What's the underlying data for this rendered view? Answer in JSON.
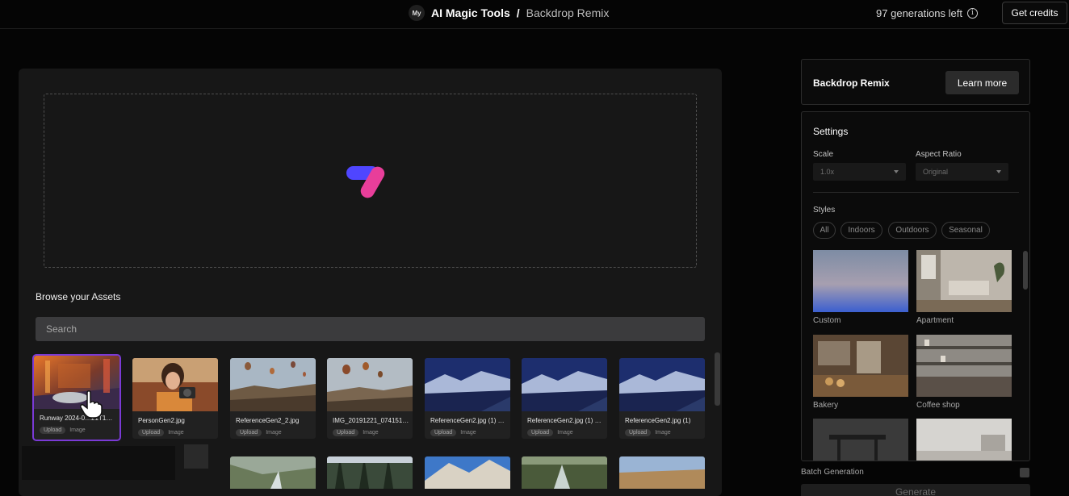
{
  "header": {
    "workspace_badge": "My",
    "app_name": "AI Magic Tools",
    "separator": "/",
    "page_name": "Backdrop Remix",
    "generations_left": "97 generations left",
    "get_credits_label": "Get credits"
  },
  "main": {
    "browse_title": "Browse your Assets",
    "search_placeholder": "Search",
    "assets": [
      {
        "name": "Runway 2024-0…21T1…",
        "tag": "Upload",
        "type": "Image"
      },
      {
        "name": "PersonGen2.jpg",
        "tag": "Upload",
        "type": "Image"
      },
      {
        "name": "ReferenceGen2_2.jpg",
        "tag": "Upload",
        "type": "Image"
      },
      {
        "name": "IMG_20191221_074151…",
        "tag": "Upload",
        "type": "Image"
      },
      {
        "name": "ReferenceGen2.jpg (1) …",
        "tag": "Upload",
        "type": "Image"
      },
      {
        "name": "ReferenceGen2.jpg (1) …",
        "tag": "Upload",
        "type": "Image"
      },
      {
        "name": "ReferenceGen2.jpg (1)",
        "tag": "Upload",
        "type": "Image"
      }
    ]
  },
  "sidebar": {
    "tool_title": "Backdrop Remix",
    "learn_more_label": "Learn more",
    "settings_title": "Settings",
    "scale_label": "Scale",
    "scale_value": "1.0x",
    "aspect_label": "Aspect Ratio",
    "aspect_value": "Original",
    "styles_label": "Styles",
    "style_filters": [
      "All",
      "Indoors",
      "Outdoors",
      "Seasonal"
    ],
    "styles": [
      "Custom",
      "Apartment",
      "Bakery",
      "Coffee shop"
    ],
    "batch_label": "Batch Generation",
    "generate_label": "Generate"
  },
  "icons": {
    "info": "info-icon",
    "cursor": "hand-pointer-icon",
    "logo": "runway-logo-icon",
    "dropdown": "chevron-down-icon"
  },
  "colors": {
    "background": "#050505",
    "panel": "#171717",
    "selected_outline": "#7a3ad6",
    "logo_blue": "#4f46ff",
    "logo_pink": "#e83e9a"
  }
}
